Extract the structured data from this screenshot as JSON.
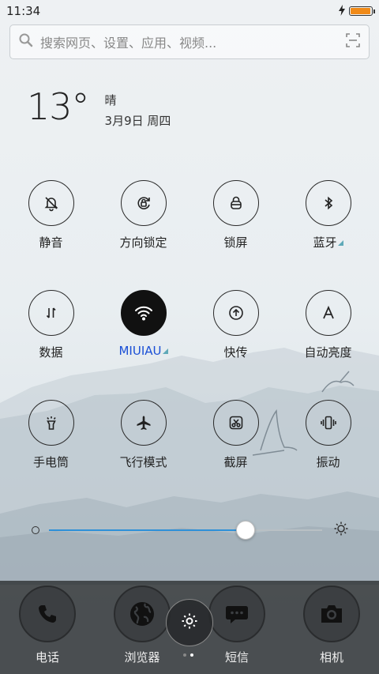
{
  "status_bar": {
    "time": "11:34",
    "battery_level": 0.95,
    "charging_icon": "bolt-icon",
    "battery_color": "#f08a18"
  },
  "search": {
    "placeholder": "搜索网页、设置、应用、视频..."
  },
  "weather": {
    "temperature": "13°",
    "condition": "晴",
    "date": "3月9日 周四"
  },
  "toggles": [
    {
      "label": "静音",
      "icon": "bell-off-icon",
      "active": false
    },
    {
      "label": "方向锁定",
      "icon": "rotation-lock-icon",
      "active": false
    },
    {
      "label": "锁屏",
      "icon": "lock-icon",
      "active": false
    },
    {
      "label": "蓝牙",
      "icon": "bluetooth-icon",
      "active": false,
      "expandable": true
    },
    {
      "label": "数据",
      "icon": "mobile-data-icon",
      "active": false
    },
    {
      "label": "MIUIAU",
      "icon": "wifi-icon",
      "active": true,
      "expandable": true
    },
    {
      "label": "快传",
      "icon": "quick-transfer-icon",
      "active": false
    },
    {
      "label": "自动亮度",
      "icon": "auto-brightness-icon",
      "active": false
    },
    {
      "label": "手电筒",
      "icon": "flashlight-icon",
      "active": false
    },
    {
      "label": "飞行模式",
      "icon": "airplane-icon",
      "active": false
    },
    {
      "label": "截屏",
      "icon": "screenshot-icon",
      "active": false
    },
    {
      "label": "振动",
      "icon": "vibrate-icon",
      "active": false
    }
  ],
  "brightness": {
    "level": 0.72,
    "accent_color": "#2e90d8"
  },
  "dock": [
    {
      "label": "电话",
      "icon": "phone-icon"
    },
    {
      "label": "浏览器",
      "icon": "globe-icon"
    },
    {
      "label": "短信",
      "icon": "message-icon"
    },
    {
      "label": "相机",
      "icon": "camera-icon"
    }
  ],
  "settings_icon": "gear-icon",
  "pages": {
    "count": 2,
    "current": 2
  }
}
